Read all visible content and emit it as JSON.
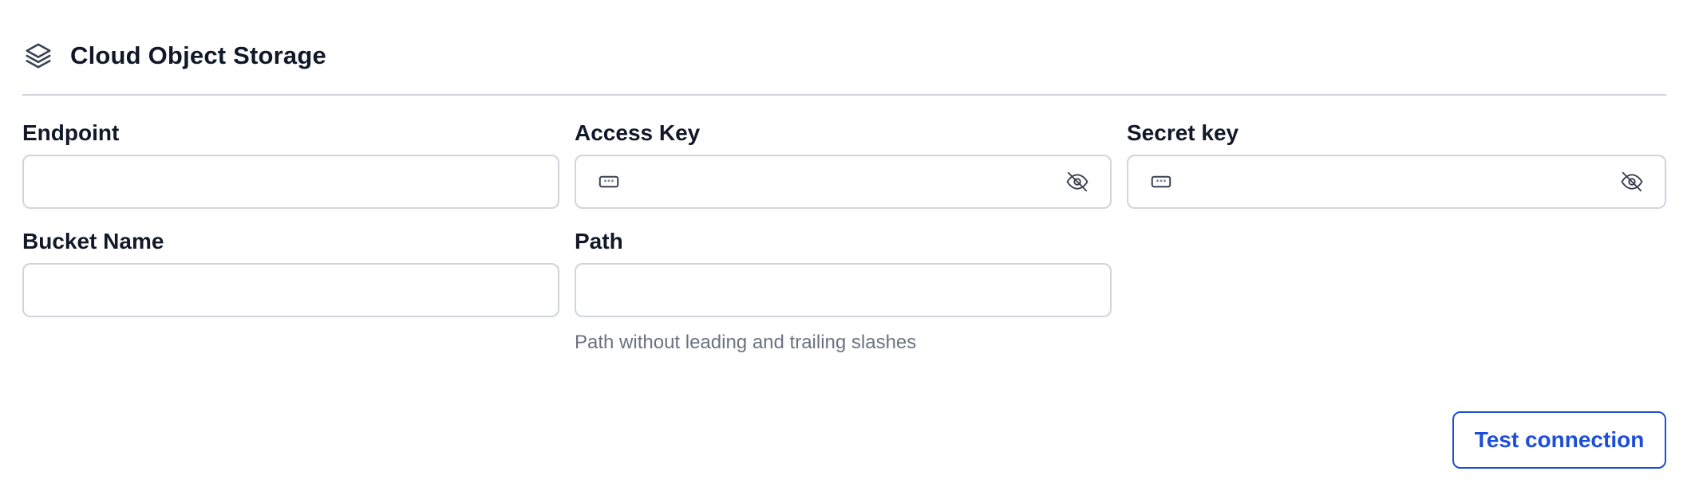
{
  "section": {
    "title": "Cloud Object Storage",
    "icon": "layers-icon"
  },
  "fields": {
    "endpoint": {
      "label": "Endpoint",
      "value": "",
      "placeholder": ""
    },
    "access_key": {
      "label": "Access Key",
      "value": "",
      "placeholder": "",
      "lead_icon": "password-icon",
      "trail_icon": "eye-off-icon"
    },
    "secret_key": {
      "label": "Secret key",
      "value": "",
      "placeholder": "",
      "lead_icon": "password-icon",
      "trail_icon": "eye-off-icon"
    },
    "bucket_name": {
      "label": "Bucket Name",
      "value": "",
      "placeholder": ""
    },
    "path": {
      "label": "Path",
      "value": "",
      "placeholder": "",
      "help": "Path without leading and trailing slashes"
    }
  },
  "actions": {
    "test_connection_label": "Test connection"
  },
  "colors": {
    "primary": "#1d4ed8",
    "text": "#111827",
    "muted": "#6b7280",
    "border": "#d1d5db"
  }
}
